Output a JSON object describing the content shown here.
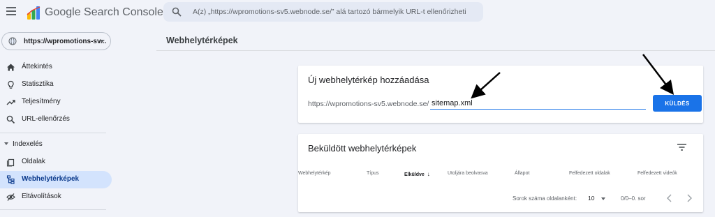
{
  "app": {
    "title": "Google Search Console",
    "search_placeholder": "A(z) „https://wpromotions-sv5.webnode.se/” alá tartozó bármelyik URL-t ellenőrizheti"
  },
  "property": {
    "label": "https://wpromotions-sv..."
  },
  "sidebar": {
    "items": [
      {
        "label": "Áttekintés",
        "icon": "home-icon"
      },
      {
        "label": "Statisztika",
        "icon": "lightbulb-icon"
      },
      {
        "label": "Teljesítmény",
        "icon": "trending-up-icon"
      },
      {
        "label": "URL-ellenőrzés",
        "icon": "search-icon"
      }
    ],
    "section": "Indexelés",
    "index_items": [
      {
        "label": "Oldalak",
        "icon": "pages-icon"
      },
      {
        "label": "Webhelytérképek",
        "icon": "sitemap-icon",
        "active": true
      },
      {
        "label": "Eltávolítások",
        "icon": "eye-off-icon"
      }
    ]
  },
  "main": {
    "page_title": "Webhelytérképek",
    "add_card": {
      "title": "Új webhelytérkép hozzáadása",
      "url_prefix": "https://wpromotions-sv5.webnode.se/",
      "input_value": "sitemap.xml",
      "submit_label": "KÜLDÉS"
    },
    "submitted_card": {
      "title": "Beküldött webhelytérképek",
      "columns": [
        "Webhelytérkép",
        "Típus",
        "Elküldve",
        "Utoljára beolvasva",
        "Állapot",
        "Felfedezett oldalak",
        "Felfedezett videók"
      ],
      "sorted_column": "Elküldve",
      "rows_per_page_label": "Sorok száma oldalanként:",
      "rows_per_page_value": "10",
      "range": "0/0–0. sor"
    }
  },
  "colors": {
    "accent": "#1a73e8",
    "active_nav": "#d3e3fd",
    "background": "#f1f3f9"
  }
}
